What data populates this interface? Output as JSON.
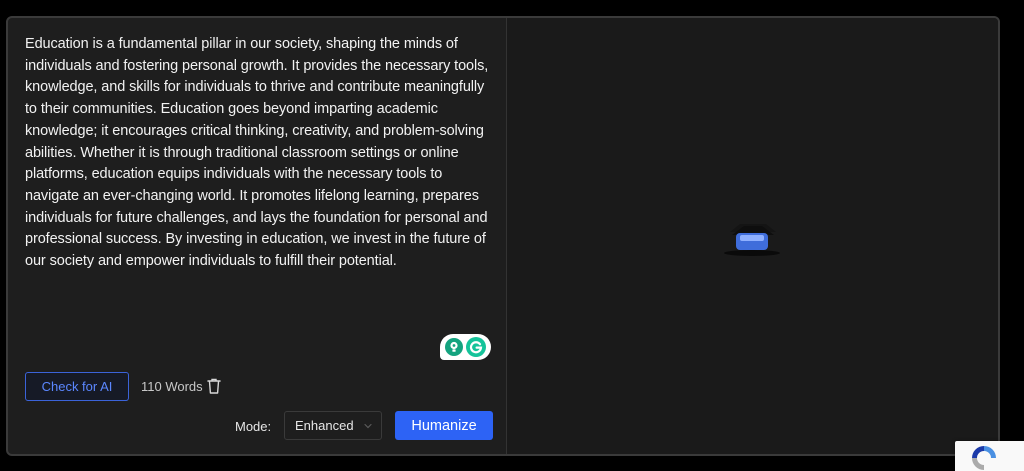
{
  "input": {
    "text": "Education is a fundamental pillar in our society, shaping the minds of individuals and fostering personal growth. It provides the necessary tools, knowledge, and skills for individuals to thrive and contribute meaningfully to their communities. Education goes beyond imparting academic knowledge; it encourages critical thinking, creativity, and problem-solving abilities. Whether it is through traditional classroom settings or online platforms, education equips individuals with the necessary tools to navigate an ever-changing world. It promotes lifelong learning, prepares individuals for future challenges, and lays the foundation for personal and professional success. By investing in education, we invest in the future of our society and empower individuals to fulfill their potential."
  },
  "toolbar": {
    "check_ai_label": "Check for AI",
    "word_count": "110 Words",
    "mode_label": "Mode:",
    "mode_value": "Enhanced",
    "humanize_label": "Humanize"
  },
  "icons": {
    "grammarly": "grammarly-icon",
    "trash": "trash-icon",
    "chevron": "chevron-down-icon",
    "output_placeholder": "empty-box-icon",
    "recaptcha": "recaptcha-icon"
  },
  "colors": {
    "accent": "#2d63f5",
    "accent_outline": "#3b63d9",
    "grammarly_green": "#15c39a"
  }
}
